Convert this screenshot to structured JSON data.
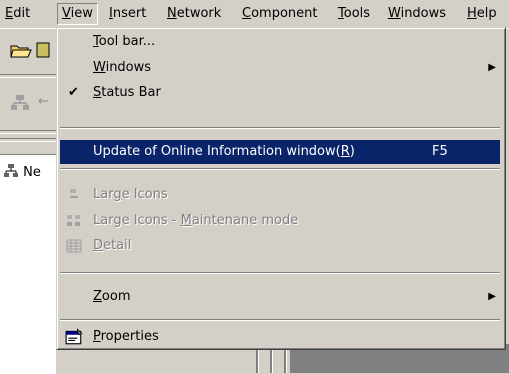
{
  "menubar": [
    {
      "label": "Edit",
      "key": "E",
      "rest": "dit"
    },
    {
      "label": "View",
      "key": "V",
      "rest": "iew"
    },
    {
      "label": "Insert",
      "key": "I",
      "rest": "nsert"
    },
    {
      "label": "Network",
      "key": "N",
      "rest": "etwork"
    },
    {
      "label": "Component",
      "key": "C",
      "rest": "omponent"
    },
    {
      "label": "Tools",
      "key": "T",
      "rest": "ools"
    },
    {
      "label": "Windows",
      "key": "W",
      "rest": "indows"
    },
    {
      "label": "Help",
      "key": "H",
      "rest": "elp"
    }
  ],
  "tree": {
    "node_label": "Ne"
  },
  "view_menu": {
    "toolbar": {
      "key": "T",
      "rest": "ool bar..."
    },
    "windows": {
      "key": "W",
      "rest": "indows"
    },
    "status_bar": {
      "key": "S",
      "rest": "tatus Bar",
      "checked": true
    },
    "update": {
      "pre": "Update of Online Information window(",
      "key": "R",
      "post": ")",
      "shortcut": "F5"
    },
    "large_icons": {
      "pre": "Lar",
      "key": "g",
      "post": "e Icons"
    },
    "large_icons_maint": {
      "pre": "Large Icons - ",
      "key": "M",
      "post": "aintenane mode"
    },
    "detail": {
      "key": "D",
      "rest": "etail"
    },
    "zoom": {
      "key": "Z",
      "rest": "oom"
    },
    "properties": {
      "key": "P",
      "rest": "roperties"
    }
  },
  "colors": {
    "highlight": "#0a246a",
    "menu_bg": "#d4d0c8"
  }
}
